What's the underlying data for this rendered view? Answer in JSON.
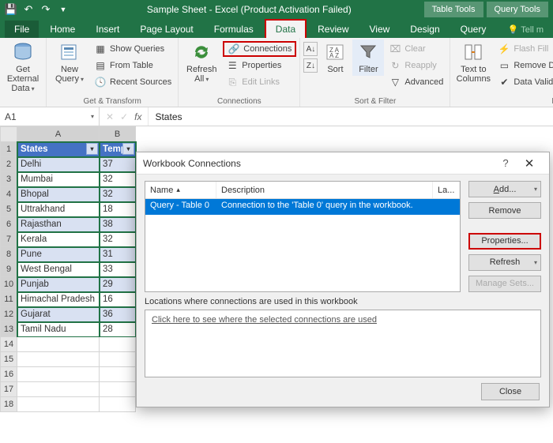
{
  "title": "Sample Sheet - Excel (Product Activation Failed)",
  "context_tabs": [
    "Table Tools",
    "Query Tools"
  ],
  "tabs": {
    "file": "File",
    "home": "Home",
    "insert": "Insert",
    "pagelayout": "Page Layout",
    "formulas": "Formulas",
    "data": "Data",
    "review": "Review",
    "view": "View",
    "design": "Design",
    "query": "Query",
    "tell": "Tell m"
  },
  "ribbon": {
    "get_external": "Get External\nData",
    "new_query": "New\nQuery",
    "show_queries": "Show Queries",
    "from_table": "From Table",
    "recent_sources": "Recent Sources",
    "get_transform_label": "Get & Transform",
    "refresh_all": "Refresh\nAll",
    "connections": "Connections",
    "properties": "Properties",
    "edit_links": "Edit Links",
    "connections_label": "Connections",
    "sort_az": "A→Z",
    "sort": "Sort",
    "filter": "Filter",
    "clear": "Clear",
    "reapply": "Reapply",
    "advanced": "Advanced",
    "sort_filter_label": "Sort & Filter",
    "text_to_columns": "Text to\nColumns",
    "flash_fill": "Flash Fill",
    "remove_dupl": "Remove Dupl",
    "data_validation": "Data Validation",
    "data_t_label": "Data T"
  },
  "namebox": "A1",
  "formula": "States",
  "columns": {
    "A": "A",
    "B": "B"
  },
  "table": {
    "headerA": "States",
    "headerB": "Temp",
    "rows": [
      {
        "a": "Delhi",
        "b": "37"
      },
      {
        "a": "Mumbai",
        "b": "32"
      },
      {
        "a": "Bhopal",
        "b": "32"
      },
      {
        "a": "Uttrakhand",
        "b": "18"
      },
      {
        "a": "Rajasthan",
        "b": "38"
      },
      {
        "a": "Kerala",
        "b": "32"
      },
      {
        "a": "Pune",
        "b": "31"
      },
      {
        "a": "West Bengal",
        "b": "33"
      },
      {
        "a": "Punjab",
        "b": "29"
      },
      {
        "a": "Himachal Pradesh",
        "b": "16"
      },
      {
        "a": "Gujarat",
        "b": "36"
      },
      {
        "a": "Tamil Nadu",
        "b": "28"
      }
    ]
  },
  "dialog": {
    "title": "Workbook Connections",
    "col_name": "Name",
    "col_desc": "Description",
    "col_la": "La...",
    "row_name": "Query - Table 0",
    "row_desc": "Connection to the 'Table 0' query in the workbook.",
    "add": "Add...",
    "remove": "Remove",
    "properties": "Properties...",
    "refresh": "Refresh",
    "manage": "Manage Sets...",
    "loc_label": "Locations where connections are used in this workbook",
    "loc_hint": "Click here to see where the selected connections are used",
    "close": "Close",
    "help": "?",
    "x": "✕"
  }
}
